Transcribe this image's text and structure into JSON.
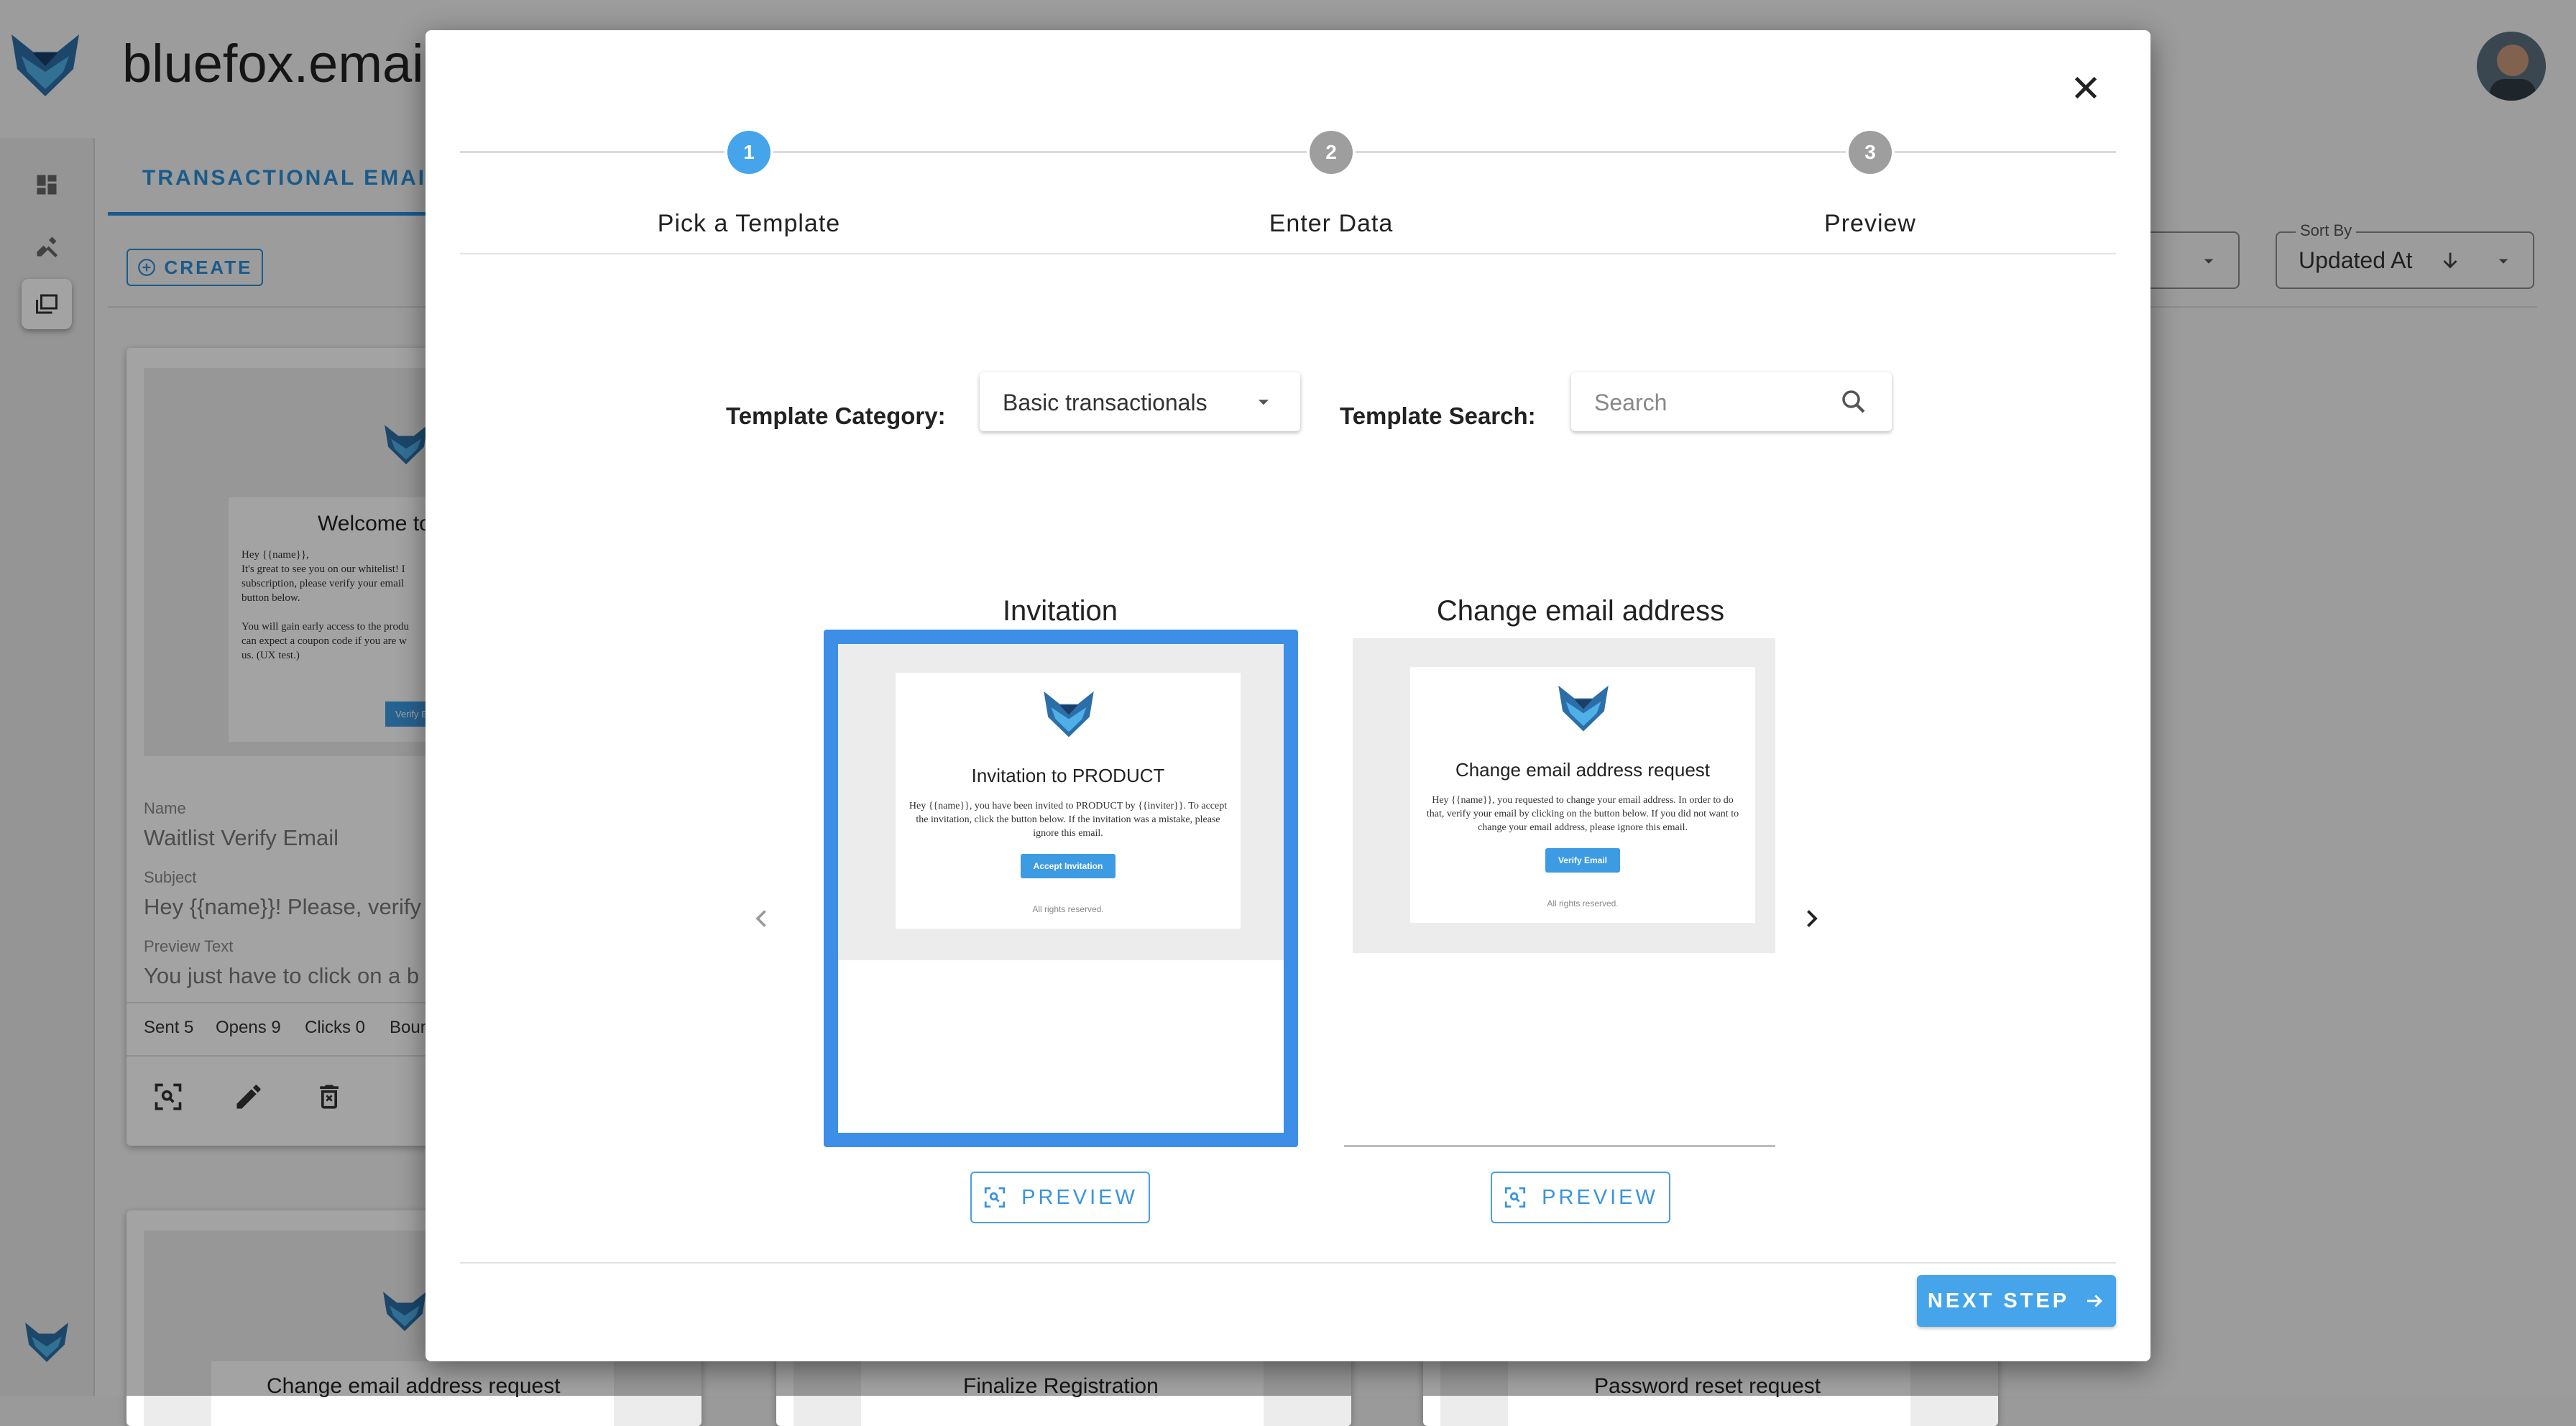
{
  "app": {
    "title": "bluefox.email",
    "tab_label": "TRANSACTIONAL EMAIL",
    "create_label": "CREATE",
    "sort": {
      "label": "Sort By",
      "value": "Updated At"
    },
    "card": {
      "preview_heading": "Welcome to",
      "preview_text_1": "Hey {{name}},",
      "preview_text_2": "It's great to see you on our whitelist! I",
      "preview_text_3": "subscription, please verify your email",
      "preview_text_4": "button below.",
      "preview_text_5": "You will gain early access to the produ",
      "preview_text_6": "can expect a coupon code if you are w",
      "preview_text_7": "us. (UX test.)",
      "preview_button": "Verify Em",
      "name_label": "Name",
      "name_value": "Waitlist Verify Email",
      "subject_label": "Subject",
      "subject_value": "Hey {{name}}! Please, verify",
      "preview_label": "Preview Text",
      "preview_value": "You just have to click on a b",
      "stat_sent": "Sent 5",
      "stat_opens": "Opens 9",
      "stat_clicks": "Clicks 0",
      "stat_bounces": "Boun"
    },
    "bottom_cards": [
      "Change email address request",
      "Finalize Registration",
      "Password reset request"
    ]
  },
  "modal": {
    "steps": [
      {
        "number": "1",
        "label": "Pick a Template"
      },
      {
        "number": "2",
        "label": "Enter Data"
      },
      {
        "number": "3",
        "label": "Preview"
      }
    ],
    "category_label": "Template Category:",
    "category_value": "Basic transactionals",
    "search_label": "Template Search:",
    "search_placeholder": "Search",
    "templates": [
      {
        "title": "Invitation",
        "mail_heading": "Invitation to PRODUCT",
        "mail_body": "Hey {{name}}, you have been invited to PRODUCT by {{inviter}}. To accept the invitation, click the button below. If the invitation was a mistake, please ignore this email.",
        "mail_button": "Accept Invitation",
        "mail_footer": "All rights reserved.",
        "selected": true
      },
      {
        "title": "Change email address",
        "mail_heading": "Change email address request",
        "mail_body": "Hey {{name}}, you requested to change your email address. In order to do that, verify your email by clicking on the button below. If you did not want to change your email address, please ignore this email.",
        "mail_button": "Verify Email",
        "mail_footer": "All rights reserved.",
        "selected": false
      }
    ],
    "preview_label": "PREVIEW",
    "next_label": "NEXT STEP",
    "colors": {
      "accent": "#45a4ea",
      "step_inactive": "#9e9e9e",
      "selected_border": "#3d8ee6"
    }
  }
}
